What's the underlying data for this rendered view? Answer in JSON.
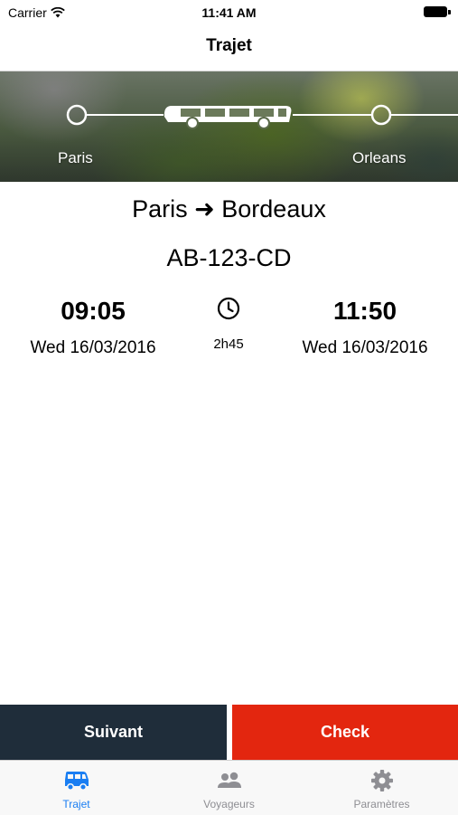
{
  "status_bar": {
    "carrier": "Carrier",
    "time": "11:41 AM"
  },
  "nav": {
    "title": "Trajet"
  },
  "route": {
    "from_stop": "Paris",
    "to_stop": "Orleans",
    "icon": "bus-icon"
  },
  "trip": {
    "title": "Paris ➜ Bordeaux",
    "plate": "AB-123-CD",
    "departure": {
      "time": "09:05",
      "date": "Wed 16/03/2016"
    },
    "duration": "2h45",
    "arrival": {
      "time": "11:50",
      "date": "Wed 16/03/2016"
    }
  },
  "actions": {
    "next_label": "Suivant",
    "check_label": "Check"
  },
  "tabs": [
    {
      "label": "Trajet",
      "icon": "bus-icon",
      "active": true
    },
    {
      "label": "Voyageurs",
      "icon": "people-icon",
      "active": false
    },
    {
      "label": "Paramètres",
      "icon": "gear-icon",
      "active": false
    }
  ],
  "colors": {
    "accent": "#1a7ef2",
    "next_button": "#1f2d3a",
    "check_button": "#e3260f",
    "tab_inactive": "#8e8e93"
  }
}
